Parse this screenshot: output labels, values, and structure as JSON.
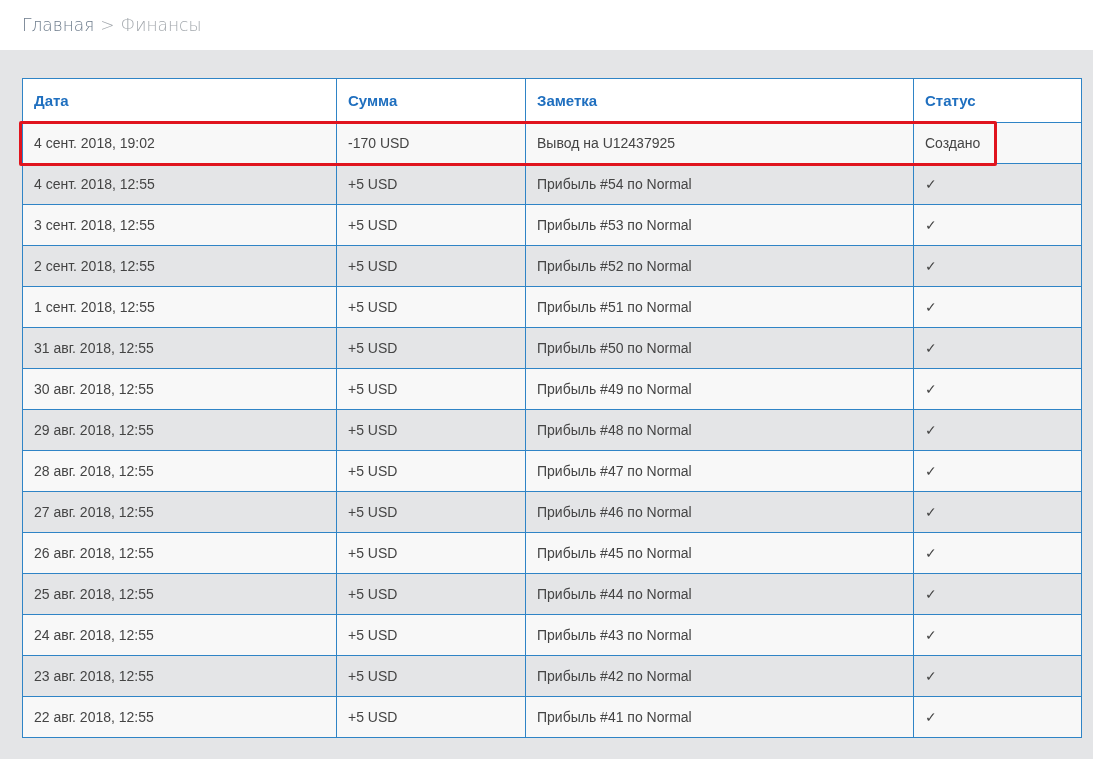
{
  "breadcrumb": {
    "items": [
      {
        "label": "Главная",
        "kind": "link"
      },
      {
        "label": ">",
        "kind": "separator"
      },
      {
        "label": "Финансы",
        "kind": "current"
      }
    ]
  },
  "table": {
    "columns": [
      "Дата",
      "Сумма",
      "Заметка",
      "Статус"
    ],
    "rows": [
      {
        "date": "4 сент. 2018, 19:02",
        "amount": "-170 USD",
        "note": "Вывод на U12437925",
        "status": "Создано",
        "highlighted": true
      },
      {
        "date": "4 сент. 2018, 12:55",
        "amount": "+5 USD",
        "note": "Прибыль #54 по Normal",
        "status": "✓",
        "highlighted": false
      },
      {
        "date": "3 сент. 2018, 12:55",
        "amount": "+5 USD",
        "note": "Прибыль #53 по Normal",
        "status": "✓",
        "highlighted": false
      },
      {
        "date": "2 сент. 2018, 12:55",
        "amount": "+5 USD",
        "note": "Прибыль #52 по Normal",
        "status": "✓",
        "highlighted": false
      },
      {
        "date": "1 сент. 2018, 12:55",
        "amount": "+5 USD",
        "note": "Прибыль #51 по Normal",
        "status": "✓",
        "highlighted": false
      },
      {
        "date": "31 авг. 2018, 12:55",
        "amount": "+5 USD",
        "note": "Прибыль #50 по Normal",
        "status": "✓",
        "highlighted": false
      },
      {
        "date": "30 авг. 2018, 12:55",
        "amount": "+5 USD",
        "note": "Прибыль #49 по Normal",
        "status": "✓",
        "highlighted": false
      },
      {
        "date": "29 авг. 2018, 12:55",
        "amount": "+5 USD",
        "note": "Прибыль #48 по Normal",
        "status": "✓",
        "highlighted": false
      },
      {
        "date": "28 авг. 2018, 12:55",
        "amount": "+5 USD",
        "note": "Прибыль #47 по Normal",
        "status": "✓",
        "highlighted": false
      },
      {
        "date": "27 авг. 2018, 12:55",
        "amount": "+5 USD",
        "note": "Прибыль #46 по Normal",
        "status": "✓",
        "highlighted": false
      },
      {
        "date": "26 авг. 2018, 12:55",
        "amount": "+5 USD",
        "note": "Прибыль #45 по Normal",
        "status": "✓",
        "highlighted": false
      },
      {
        "date": "25 авг. 2018, 12:55",
        "amount": "+5 USD",
        "note": "Прибыль #44 по Normal",
        "status": "✓",
        "highlighted": false
      },
      {
        "date": "24 авг. 2018, 12:55",
        "amount": "+5 USD",
        "note": "Прибыль #43 по Normal",
        "status": "✓",
        "highlighted": false
      },
      {
        "date": "23 авг. 2018, 12:55",
        "amount": "+5 USD",
        "note": "Прибыль #42 по Normal",
        "status": "✓",
        "highlighted": false
      },
      {
        "date": "22 авг. 2018, 12:55",
        "amount": "+5 USD",
        "note": "Прибыль #41 по Normal",
        "status": "✓",
        "highlighted": false
      }
    ]
  }
}
